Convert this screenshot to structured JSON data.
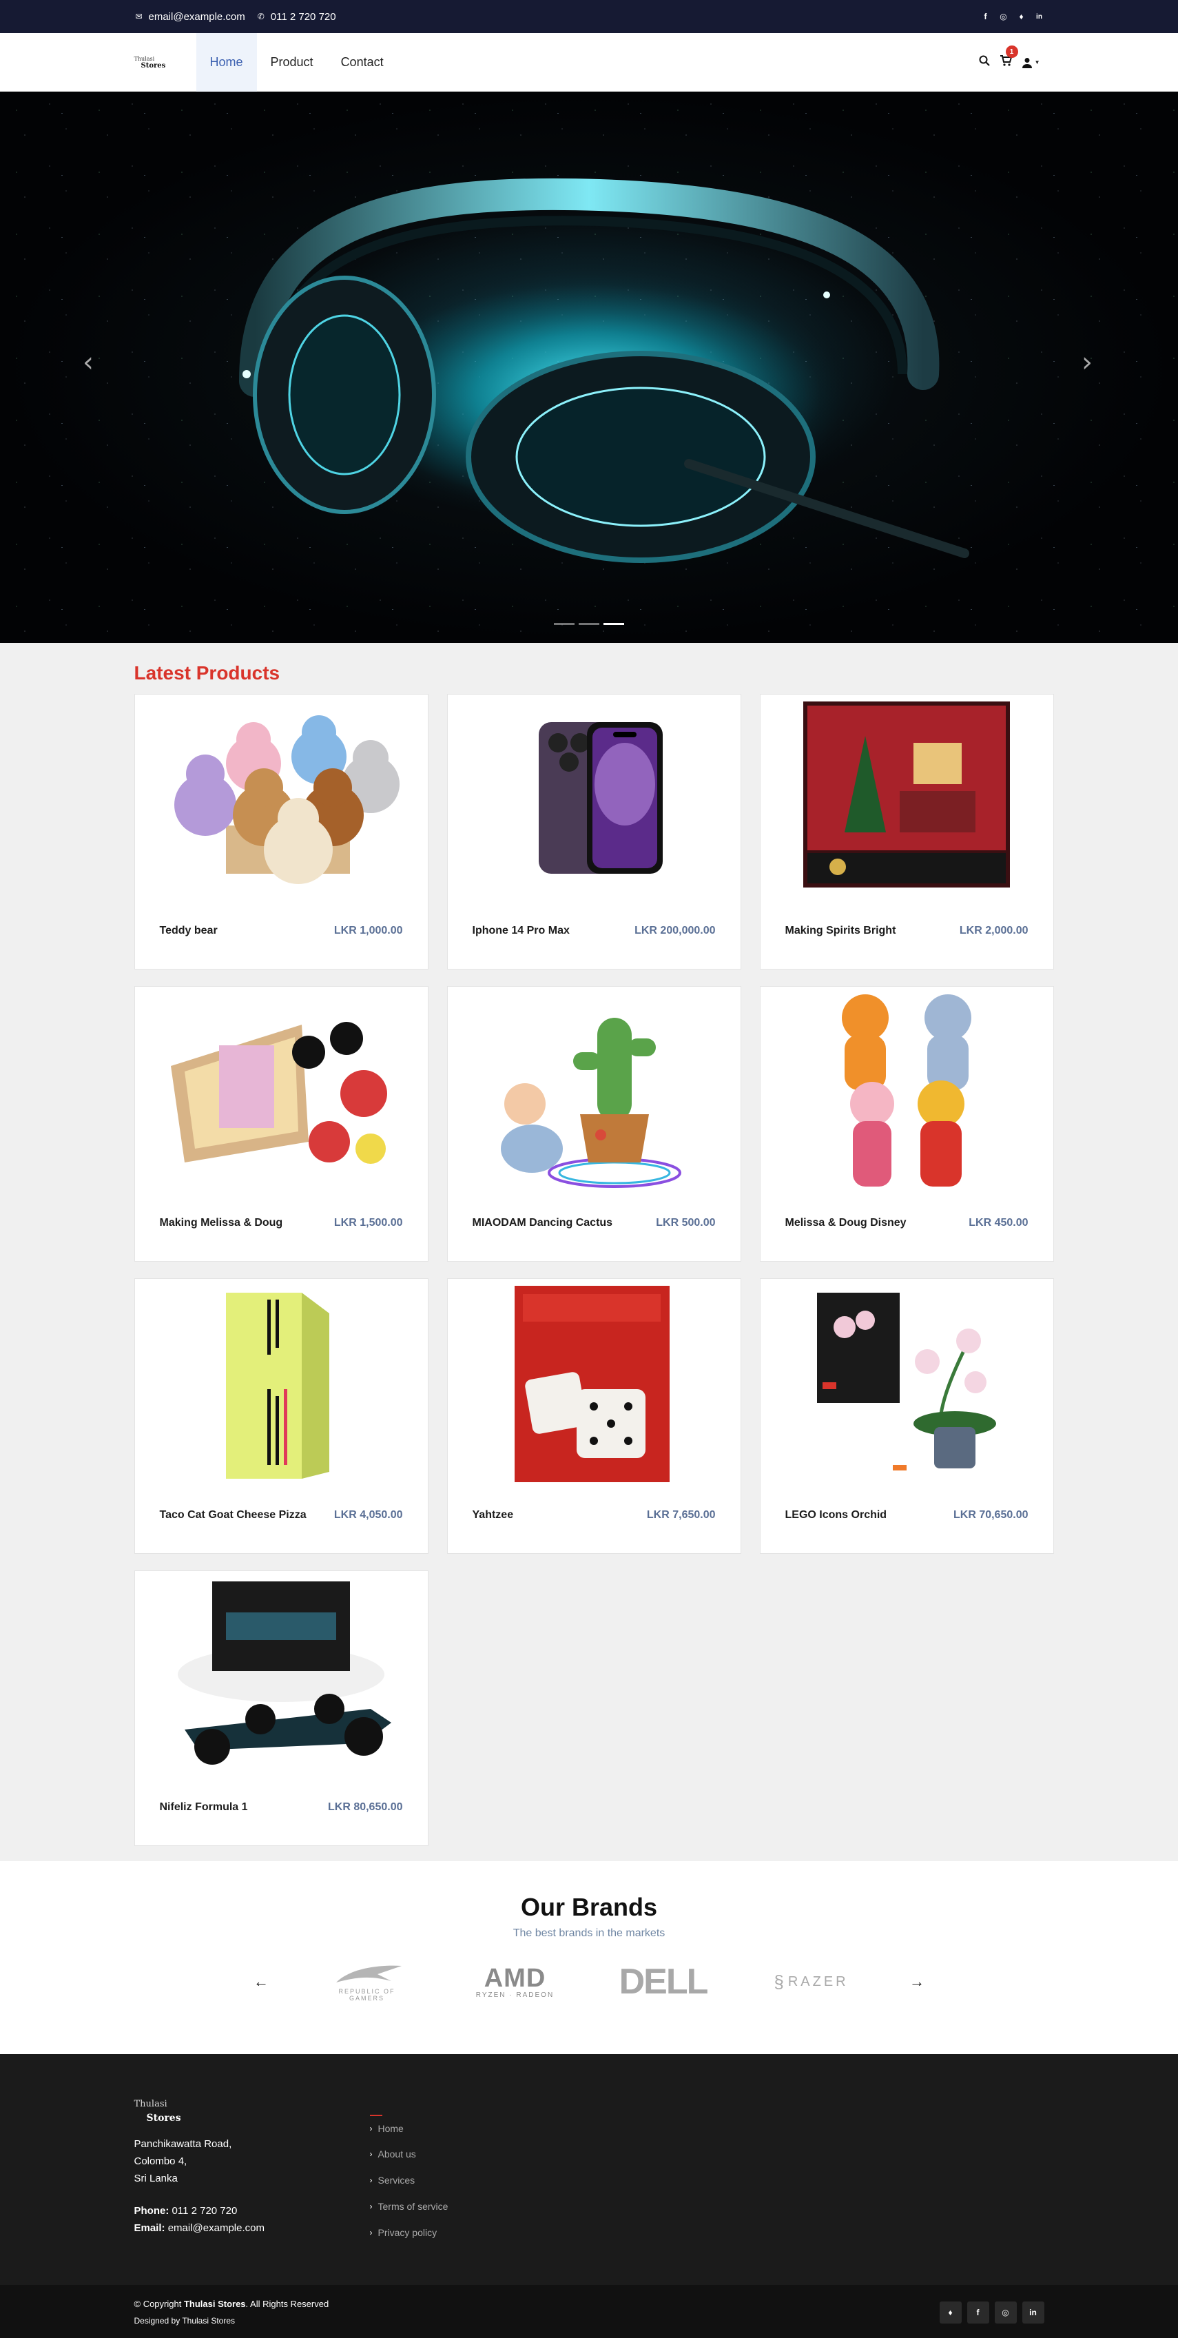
{
  "topbar": {
    "email": "email@example.com",
    "phone": "011 2 720 720",
    "social_icons": [
      "facebook-icon",
      "instagram-icon",
      "twitter-icon",
      "linkedin-icon"
    ]
  },
  "header": {
    "logo_line1": "Thulasi",
    "logo_line2": "Stores",
    "nav": [
      "Home",
      "Product",
      "Contact"
    ],
    "cart_count": "1"
  },
  "hero": {
    "prev": "‹",
    "next": "›",
    "slides_count": 3,
    "active_slide": 3
  },
  "latest": {
    "title": "Latest Products",
    "products": [
      {
        "name": "Teddy bear",
        "price": "LKR 1,000.00"
      },
      {
        "name": "Iphone 14 Pro Max",
        "price": "LKR 200,000.00"
      },
      {
        "name": "Making Spirits Bright",
        "price": "LKR 2,000.00"
      },
      {
        "name": "Making Melissa & Doug",
        "price": "LKR 1,500.00"
      },
      {
        "name": "MIAODAM Dancing Cactus",
        "price": "LKR 500.00"
      },
      {
        "name": "Melissa & Doug Disney",
        "price": "LKR 450.00"
      },
      {
        "name": "Taco Cat Goat Cheese Pizza",
        "price": "LKR 4,050.00"
      },
      {
        "name": "Yahtzee",
        "price": "LKR 7,650.00"
      },
      {
        "name": "LEGO Icons Orchid",
        "price": "LKR 70,650.00"
      },
      {
        "name": "Nifeliz Formula 1",
        "price": "LKR 80,650.00"
      }
    ]
  },
  "brands": {
    "title": "Our Brands",
    "subtitle": "The best brands in the markets",
    "prev": "←",
    "next": "→",
    "rog_top": "REPUBLIC OF",
    "rog_bottom": "GAMERS",
    "amd": "AMD",
    "amd_sub": "RYZEN · RADEON",
    "dell": "DELL",
    "razer": "RAZER"
  },
  "footer": {
    "logo_line1": "Thulasi",
    "logo_line2": "Stores",
    "address1": "Panchikawatta Road,",
    "address2": "Colombo 4,",
    "address3": "Sri Lanka",
    "phone_label": "Phone:",
    "phone": "011 2 720 720",
    "email_label": "Email:",
    "email": "email@example.com",
    "links": [
      "Home",
      "About us",
      "Services",
      "Terms of service",
      "Privacy policy"
    ]
  },
  "bottom": {
    "copyright_prefix": "© Copyright",
    "brand": "Thulasi Stores",
    "copyright_suffix": ". All Rights Reserved",
    "designed": "Designed by Thulasi Stores"
  }
}
